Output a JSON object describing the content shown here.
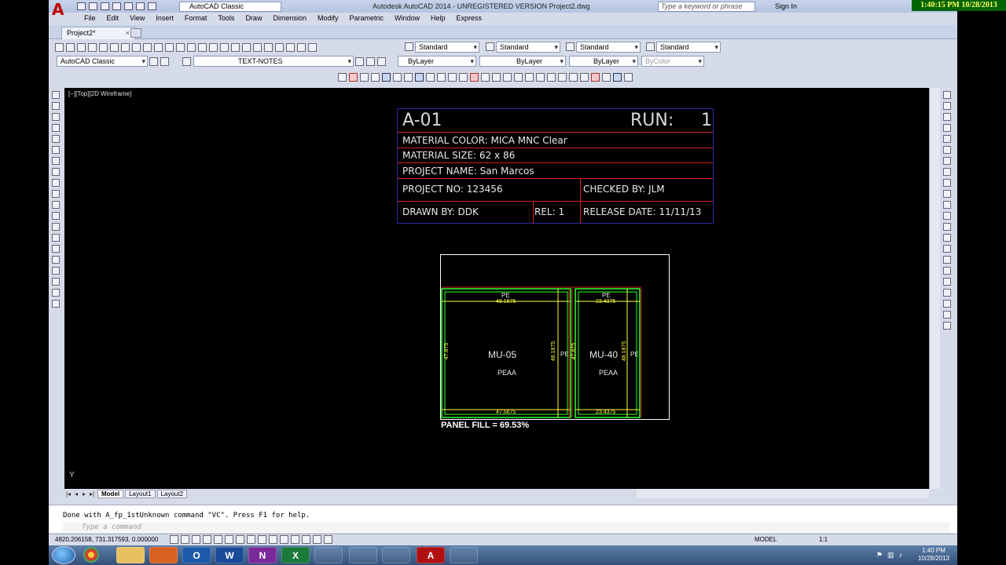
{
  "app": {
    "title": "Autodesk AutoCAD 2014 - UNREGISTERED VERSION    Project2.dwg",
    "workspace": "AutoCAD Classic",
    "search_placeholder": "Type a keyword or phrase",
    "signin": "Sign In",
    "clock": "1:40:15 PM 10/28/2013"
  },
  "menu": [
    "File",
    "Edit",
    "View",
    "Insert",
    "Format",
    "Tools",
    "Draw",
    "Dimension",
    "Modify",
    "Parametric",
    "Window",
    "Help",
    "Express"
  ],
  "doc_tab": {
    "label": "Project2*",
    "close": "×"
  },
  "toolbars": {
    "text_style": "Standard",
    "dim_style": "Standard",
    "table_style": "Standard",
    "mleader_style": "Standard",
    "workspace_combo": "AutoCAD Classic",
    "layer": "TEXT-NOTES",
    "color": "ByLayer",
    "linetype": "ByLayer",
    "lineweight": "ByLayer",
    "plotstyle": "ByColor"
  },
  "viewport": {
    "label": "[−][Top][2D Wireframe]",
    "ucs_y": "Y"
  },
  "titleblock": {
    "sheet_id": "A-01",
    "run_label": "RUN:",
    "run_value": "1",
    "material_color": "MATERIAL COLOR:  MICA MNC Clear",
    "material_size": "MATERIAL SIZE: 62 x 86",
    "project_name": "PROJECT NAME: San Marcos",
    "project_no": "PROJECT NO: 123456",
    "checked_by": "CHECKED BY: JLM",
    "drawn_by": "DRAWN BY: DDK",
    "rel": "REL: 1",
    "release_date": "RELEASE DATE: 11/11/13"
  },
  "panels": [
    {
      "id": "MU-05",
      "finish": "PEAA",
      "top_edge": "PE",
      "top_dim": "48.1875",
      "bottom_dim": "47.5675",
      "left_dim": "47.875",
      "right_dim": "48.1875",
      "side": "PE"
    },
    {
      "id": "MU-40",
      "finish": "PEAA",
      "top_edge": "PE",
      "top_dim": "23.4375",
      "bottom_dim": "23.4375",
      "left_dim": "47.875",
      "right_dim": "48.1875",
      "side": "PE"
    }
  ],
  "panel_fill": "PANEL FILL = 69.53%",
  "layout_tabs": [
    "Model",
    "Layout1",
    "Layout2"
  ],
  "command": {
    "history": "Done with A_fp_1stUnknown command \"VC\".  Press F1 for help.",
    "prompt": "Type a command"
  },
  "status": {
    "coords": "4820.206158, 731.317593, 0.000000",
    "model": "MODEL",
    "scale": "1:1"
  },
  "taskbar": {
    "apps": [
      "chrome-icon",
      "explorer-icon",
      "media-icon",
      "outlook-icon",
      "word-icon",
      "onenote-icon",
      "excel-icon",
      "tool-icon",
      "app-icon",
      "notepad-icon",
      "autocad-icon",
      "app2-icon"
    ],
    "time": "1:40 PM",
    "date": "10/28/2013"
  },
  "colors": {
    "titlebar": "#c7d3ea",
    "canvas": "#000000",
    "clock_bg": "#006400",
    "clock_fg": "#ffff66",
    "panel_outline": "#30ff30",
    "dim_yellow": "#ffff40",
    "red_line": "#d02020"
  }
}
